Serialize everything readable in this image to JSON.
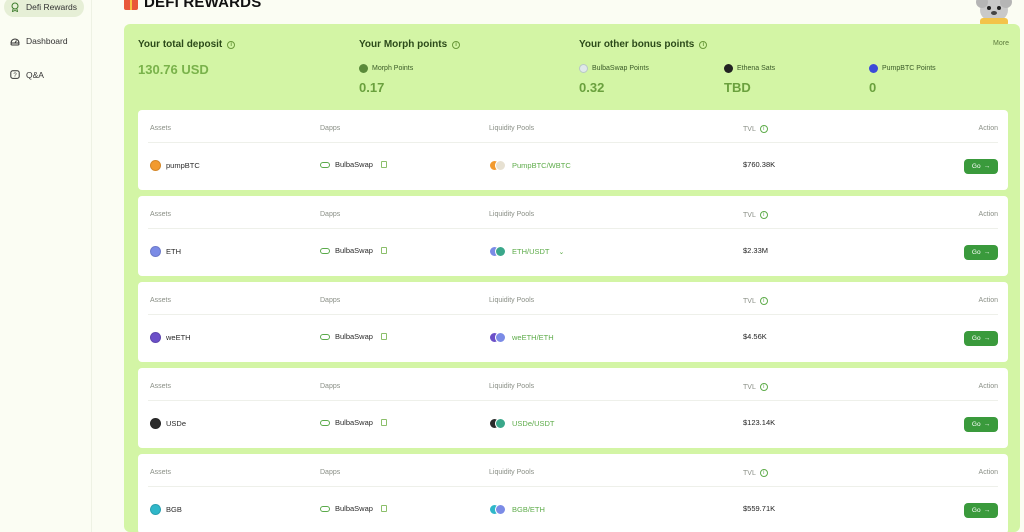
{
  "sidebar": {
    "items": [
      {
        "label": "Defi Rewards",
        "icon": "medal-icon"
      },
      {
        "label": "Dashboard",
        "icon": "dashboard-icon"
      },
      {
        "label": "Q&A",
        "icon": "question-icon"
      }
    ]
  },
  "header": {
    "title": "DEFI REWARDS"
  },
  "summary": {
    "deposit_label": "Your total deposit",
    "deposit_value": "130.76 USD",
    "morph_label": "Your Morph points",
    "morph_sub": "Morph Points",
    "morph_value": "0.17",
    "bonus_label": "Your other bonus points",
    "more": "More",
    "bonus": [
      {
        "name": "BulbaSwap Points",
        "value": "0.32",
        "color": "#dfe9ea"
      },
      {
        "name": "Ethena Sats",
        "value": "TBD",
        "color": "#222222"
      },
      {
        "name": "PumpBTC Points",
        "value": "0",
        "color": "#3b4bd8"
      }
    ]
  },
  "table_headers": {
    "assets": "Assets",
    "dapps": "Dapps",
    "pools": "Liquidity Pools",
    "tvl": "TVL",
    "action": "Action"
  },
  "pools": [
    {
      "asset": "pumpBTC",
      "asset_color": "#f29a2e",
      "dapp": "BulbaSwap",
      "pool": "PumpBTC/WBTC",
      "coins": [
        "#f29a2e",
        "#e7e1d2"
      ],
      "tvl": "$760.38K",
      "go": "Go",
      "chevron": false
    },
    {
      "asset": "ETH",
      "asset_color": "#7b8be6",
      "dapp": "BulbaSwap",
      "pool": "ETH/USDT",
      "coins": [
        "#7b8be6",
        "#3aa78a"
      ],
      "tvl": "$2.33M",
      "go": "Go",
      "chevron": true
    },
    {
      "asset": "weETH",
      "asset_color": "#6b4fc8",
      "dapp": "BulbaSwap",
      "pool": "weETH/ETH",
      "coins": [
        "#6b4fc8",
        "#7b8be6"
      ],
      "tvl": "$4.56K",
      "go": "Go",
      "chevron": false
    },
    {
      "asset": "USDe",
      "asset_color": "#2b2b2b",
      "dapp": "BulbaSwap",
      "pool": "USDe/USDT",
      "coins": [
        "#2b2b2b",
        "#3aa78a"
      ],
      "tvl": "$123.14K",
      "go": "Go",
      "chevron": false
    },
    {
      "asset": "BGB",
      "asset_color": "#2fb7c9",
      "dapp": "BulbaSwap",
      "pool": "BGB/ETH",
      "coins": [
        "#2fb7c9",
        "#7b8be6"
      ],
      "tvl": "$559.71K",
      "go": "Go",
      "chevron": false
    }
  ],
  "colors": {
    "panel": "#d3f5a5",
    "accent": "#3a9a3c",
    "link": "#5eac4a"
  }
}
